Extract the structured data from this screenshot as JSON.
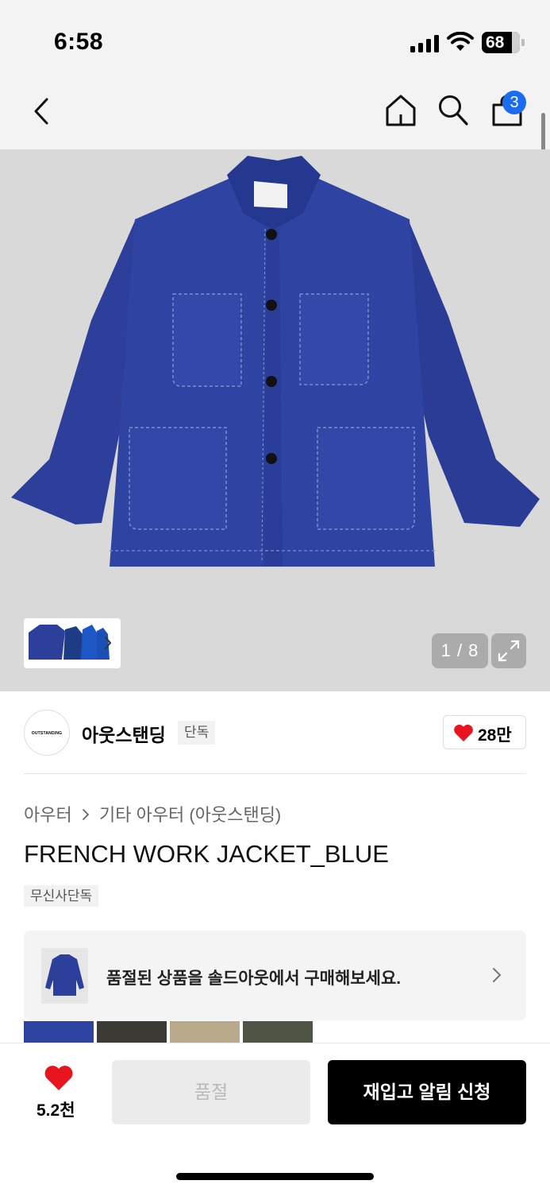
{
  "status_bar": {
    "time": "6:58",
    "battery": "68"
  },
  "nav": {
    "cart_count": "3"
  },
  "gallery": {
    "counter": "1 / 8"
  },
  "brand": {
    "logo_text": "OUTSTANDING",
    "name": "아웃스탠딩",
    "tag": "단독",
    "like_count": "28만"
  },
  "breadcrumb": {
    "category": "아우터",
    "subcategory": "기타 아우터 (아웃스탠딩)"
  },
  "product": {
    "title": "FRENCH WORK JACKET_BLUE",
    "tag": "무신사단독"
  },
  "soldout_banner": {
    "text": "품절된 상품을 솔드아웃에서 구매해보세요."
  },
  "bottom_bar": {
    "wish_count": "5.2천",
    "soldout_label": "품절",
    "restock_label": "재입고 알림 신청"
  },
  "colors": {
    "jacket": "#2c3f9a",
    "cart_badge": "#1c6cf2",
    "heart": "#e8141f"
  },
  "icons": [
    "back-icon",
    "home-icon",
    "search-icon",
    "cart-icon",
    "expand-icon",
    "heart-icon",
    "chevron-right-icon"
  ]
}
